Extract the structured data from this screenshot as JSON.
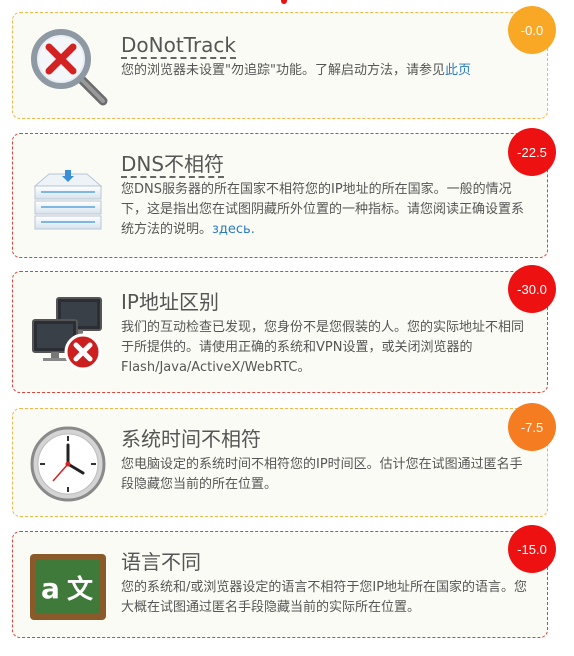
{
  "checks": [
    {
      "title": "DoNotTrack",
      "desc_text": "您的浏览器未设置\"勿追踪\"功能。了解启动方法，请参见",
      "link": "此页",
      "score": "-0.0",
      "icon": "magnifier-x-icon",
      "score_color": "#f9a825"
    },
    {
      "title": "DNS不相符",
      "desc_text": "您DNS服务器的所在国家不相符您的IP地址的所在国家。一般的情况下，这是指出您在试图阴藏所外位置的一种指标。请您阅读正确设置系统方法的说明。",
      "link": "здесь.",
      "score": "-22.5",
      "icon": "dns-server-icon",
      "score_color": "#ee1111"
    },
    {
      "title": "IP地址区别",
      "desc_text": "我们的互动检查已发现，您身份不是您假装的人。您的实际地址不相同于所提供的。请使用正确的系统和VPN设置，或关闭浏览器的Flash/Java/ActiveX/WebRTC。",
      "score": "-30.0",
      "icon": "network-x-icon",
      "score_color": "#ee1111"
    },
    {
      "title": "系统时间不相符",
      "desc_text": "您电脑设定的系统时间不相符您的IP时间区。估计您在试图通过匿名手段隐藏您当前的所在位置。",
      "score": "-7.5",
      "icon": "clock-icon",
      "score_color": "#f57c20"
    },
    {
      "title": "语言不同",
      "desc_text": "您的系统和/或浏览器设定的语言不相符于您IP地址所在国家的语言。您大概在试图通过匿名手段隐藏当前的实际所在位置。",
      "score": "-15.0",
      "icon": "language-board-icon",
      "score_color": "#ee1111"
    }
  ]
}
